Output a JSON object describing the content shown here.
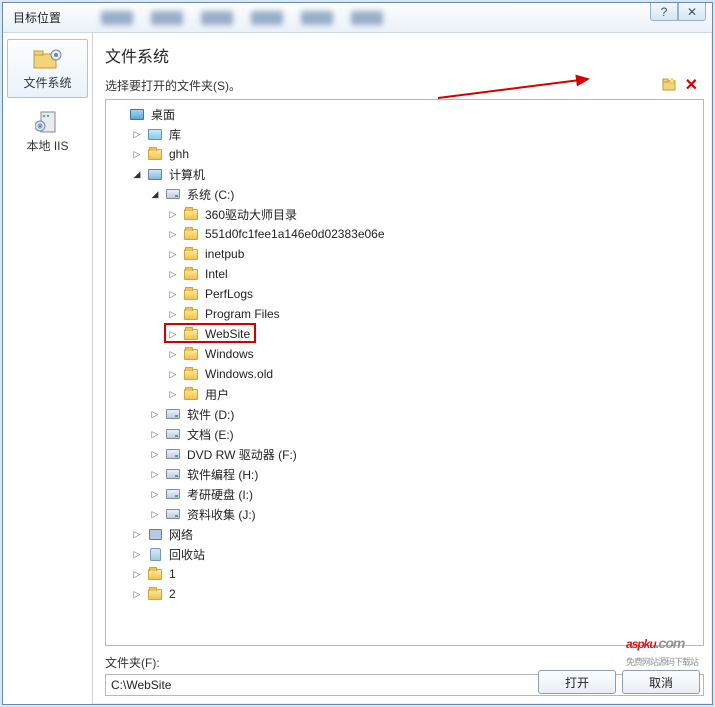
{
  "dialog": {
    "title": "目标位置"
  },
  "sidebar": {
    "items": [
      {
        "label": "文件系统",
        "selected": true,
        "icon": "filesystem"
      },
      {
        "label": "本地 IIS",
        "selected": false,
        "icon": "iis"
      }
    ]
  },
  "main": {
    "title": "文件系统",
    "subtitle": "选择要打开的文件夹(S)。",
    "new_folder_tooltip": "新建文件夹",
    "delete_tooltip": "删除"
  },
  "tree": [
    {
      "depth": 0,
      "exp": "blank",
      "icon": "desktop",
      "label": "桌面"
    },
    {
      "depth": 1,
      "exp": "closed",
      "icon": "lib",
      "label": "库"
    },
    {
      "depth": 1,
      "exp": "closed",
      "icon": "folder",
      "label": "ghh"
    },
    {
      "depth": 1,
      "exp": "open",
      "icon": "computer",
      "label": "计算机"
    },
    {
      "depth": 2,
      "exp": "open",
      "icon": "drive",
      "label": "系统 (C:)"
    },
    {
      "depth": 3,
      "exp": "closed",
      "icon": "folder",
      "label": "360驱动大师目录"
    },
    {
      "depth": 3,
      "exp": "closed",
      "icon": "folder",
      "label": "551d0fc1fee1a146e0d02383e06e"
    },
    {
      "depth": 3,
      "exp": "closed",
      "icon": "folder",
      "label": "inetpub"
    },
    {
      "depth": 3,
      "exp": "closed",
      "icon": "folder",
      "label": "Intel"
    },
    {
      "depth": 3,
      "exp": "closed",
      "icon": "folder",
      "label": "PerfLogs"
    },
    {
      "depth": 3,
      "exp": "closed",
      "icon": "folder",
      "label": "Program Files"
    },
    {
      "depth": 3,
      "exp": "closed",
      "icon": "folder",
      "label": "WebSite",
      "highlight": true
    },
    {
      "depth": 3,
      "exp": "closed",
      "icon": "folder",
      "label": "Windows"
    },
    {
      "depth": 3,
      "exp": "closed",
      "icon": "folder",
      "label": "Windows.old"
    },
    {
      "depth": 3,
      "exp": "closed",
      "icon": "folder",
      "label": "用户"
    },
    {
      "depth": 2,
      "exp": "closed",
      "icon": "drive",
      "label": "软件 (D:)"
    },
    {
      "depth": 2,
      "exp": "closed",
      "icon": "drive",
      "label": "文档 (E:)"
    },
    {
      "depth": 2,
      "exp": "closed",
      "icon": "drive",
      "label": "DVD RW 驱动器 (F:)"
    },
    {
      "depth": 2,
      "exp": "closed",
      "icon": "drive",
      "label": "软件编程 (H:)"
    },
    {
      "depth": 2,
      "exp": "closed",
      "icon": "drive",
      "label": "考研硬盘 (I:)"
    },
    {
      "depth": 2,
      "exp": "closed",
      "icon": "drive",
      "label": "资料收集 (J:)"
    },
    {
      "depth": 1,
      "exp": "closed",
      "icon": "network",
      "label": "网络"
    },
    {
      "depth": 1,
      "exp": "closed",
      "icon": "recycle",
      "label": "回收站"
    },
    {
      "depth": 1,
      "exp": "closed",
      "icon": "folder",
      "label": "1"
    },
    {
      "depth": 1,
      "exp": "closed",
      "icon": "folder",
      "label": "2"
    }
  ],
  "footer": {
    "label": "文件夹(F):",
    "path": "C:\\WebSite"
  },
  "buttons": {
    "open": "打开",
    "cancel": "取消"
  },
  "watermark": {
    "text": "aspku",
    "sub": "免费网站源码下载站"
  }
}
